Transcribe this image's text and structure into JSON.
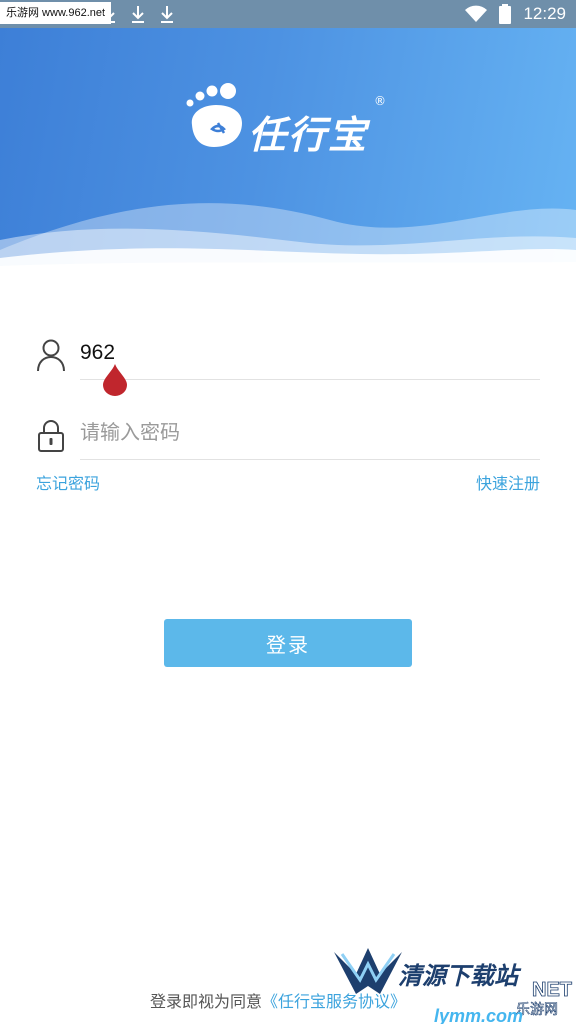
{
  "status_bar": {
    "watermark": "乐游网 www.962.net",
    "time": "12:29",
    "icons": [
      "download-icon",
      "download-icon",
      "download-icon",
      "wifi-icon",
      "battery-icon"
    ]
  },
  "header": {
    "app_name": "任行宝",
    "registered_mark": "®",
    "colors": {
      "gradient_start": "#3d7fd7",
      "gradient_end": "#66b3f3"
    }
  },
  "form": {
    "username": {
      "value": "962",
      "icon": "user-icon"
    },
    "password": {
      "value": "",
      "placeholder": "请输入密码",
      "icon": "lock-icon"
    },
    "forgot_password": "忘记密码",
    "quick_register": "快速注册",
    "login_button": "登录"
  },
  "footer": {
    "agreement_prefix": "登录即视为同意",
    "agreement_link": "《任行宝服务协议》"
  },
  "watermark_bottom": {
    "brand": "清源下载站",
    "side_text": "NET",
    "site": "乐游网",
    "url": "lymm.com"
  },
  "accent_color": "#3ba3dd",
  "button_color": "#5cb8ea"
}
